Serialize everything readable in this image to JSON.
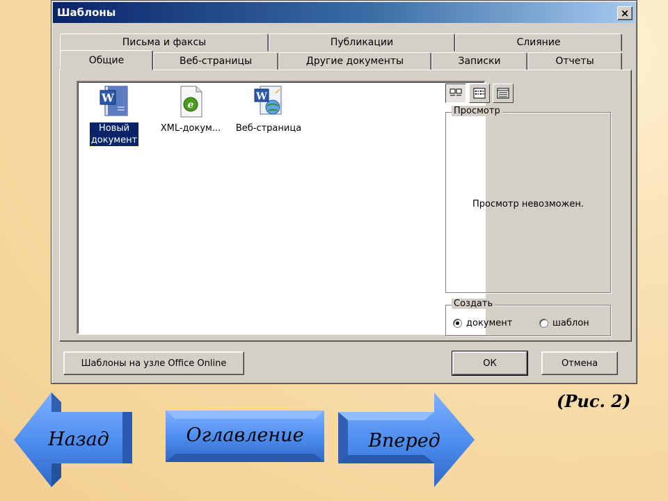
{
  "dialog": {
    "title": "Шаблоны",
    "close_label": "×",
    "tabs_row1": [
      "Письма и факсы",
      "Публикации",
      "Слияние"
    ],
    "tabs_row2": [
      "Общие",
      "Веб-страницы",
      "Другие документы",
      "Записки",
      "Отчеты"
    ],
    "active_tab": "Общие",
    "files": [
      {
        "label_line1": "Новый",
        "label_line2": "документ",
        "icon": "word-document-icon",
        "selected": true
      },
      {
        "label": "XML-докум...",
        "icon": "xml-document-icon",
        "selected": false
      },
      {
        "label": "Веб-страница",
        "icon": "web-page-icon",
        "selected": false
      }
    ],
    "view_buttons": [
      "large-icons-view-icon",
      "list-view-icon",
      "details-view-icon"
    ],
    "preview": {
      "label": "Просмотр",
      "message": "Просмотр невозможен."
    },
    "create": {
      "label": "Создать",
      "option_document": "документ",
      "option_template": "шаблон",
      "selected": "документ"
    },
    "online_button": "Шаблоны на узле Office Online",
    "ok_button": "ОК",
    "cancel_button": "Отмена"
  },
  "caption": "(Рис. 2)",
  "nav": {
    "back": "Назад",
    "contents": "Оглавление",
    "forward": "Вперед"
  },
  "colors": {
    "titlebar_start": "#0a246a",
    "titlebar_end": "#a6caf0",
    "dialog_face": "#d4d0c8",
    "nav_blue": "#4d8ff0",
    "page_bg": "#f6d9a2"
  }
}
